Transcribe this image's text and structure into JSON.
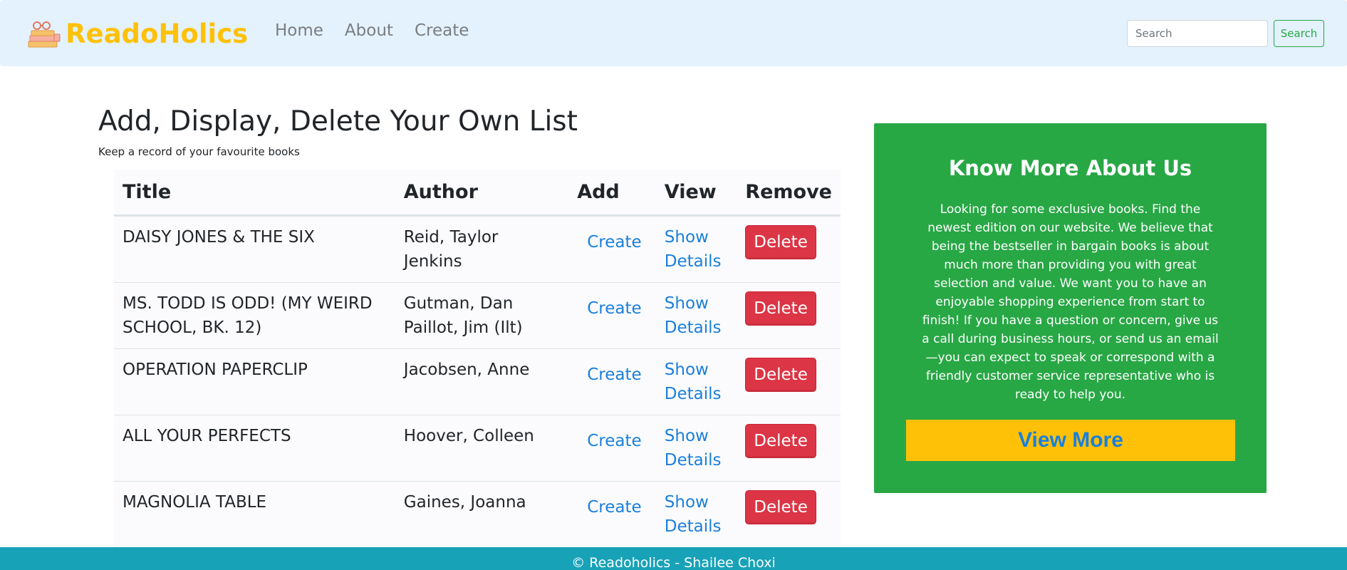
{
  "brand": {
    "name": "ReadoHolics",
    "logo_icon": "books-glasses-icon"
  },
  "nav": {
    "items": [
      {
        "label": "Home"
      },
      {
        "label": "About"
      },
      {
        "label": "Create"
      }
    ]
  },
  "search": {
    "placeholder": "Search",
    "button_label": "Search"
  },
  "page": {
    "title": "Add, Display, Delete Your Own List",
    "subtitle": "Keep a record of your favourite books"
  },
  "table": {
    "headers": {
      "title": "Title",
      "author": "Author",
      "add": "Add",
      "view": "View",
      "remove": "Remove"
    },
    "rows": [
      {
        "title": "DAISY JONES & THE SIX",
        "author": "Reid, Taylor Jenkins",
        "add": "Create",
        "view": "Show Details",
        "remove": "Delete"
      },
      {
        "title": "MS. TODD IS ODD! (MY WEIRD SCHOOL, BK. 12)",
        "author": "Gutman, Dan Paillot, Jim (Ilt)",
        "add": "Create",
        "view": "Show Details",
        "remove": "Delete"
      },
      {
        "title": "OPERATION PAPERCLIP",
        "author": "Jacobsen, Anne",
        "add": "Create",
        "view": "Show Details",
        "remove": "Delete"
      },
      {
        "title": "ALL YOUR PERFECTS",
        "author": "Hoover, Colleen",
        "add": "Create",
        "view": "Show Details",
        "remove": "Delete"
      },
      {
        "title": "MAGNOLIA TABLE",
        "author": "Gaines, Joanna",
        "add": "Create",
        "view": "Show Details",
        "remove": "Delete"
      }
    ]
  },
  "about": {
    "title": "Know More About Us",
    "text": "Looking for some exclusive books. Find the newest edition on our website. We believe that being the bestseller in bargain books is about much more than providing you with great selection and value. We want you to have an enjoyable shopping experience from start to finish! If you have a question or concern, give us a call during business hours, or send us an email—you can expect to speak or correspond with a friendly customer service representative who is ready to help you.",
    "button_label": "View More"
  },
  "footer": {
    "text": "© Readoholics - Shailee Choxi"
  },
  "colors": {
    "navbar_bg": "#e3f2fd",
    "brand": "#ffc107",
    "link": "#1a7fdb",
    "danger": "#dc3545",
    "card_bg": "#28a745",
    "footer_bg": "#17a2b8"
  }
}
